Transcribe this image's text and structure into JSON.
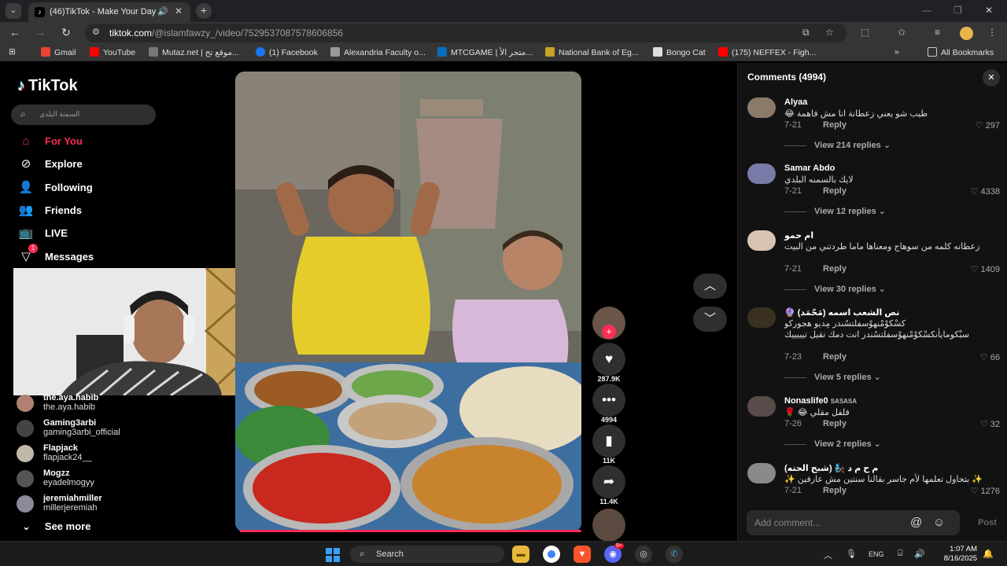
{
  "browser": {
    "tab_title": "(46)TikTok - Make Your Day",
    "url_host": "tiktok.com",
    "url_path": "/@islamfawzy_/video/7529537087578606856",
    "bookmarks": [
      "Gmail",
      "YouTube",
      "Mutaz.net | موقع تح...",
      "(1) Facebook",
      "Alexandria Faculty o...",
      "MTCGAME | متجر الأ...",
      "National Bank of Eg...",
      "Bongo Cat",
      "(175) NEFFEX - Figh..."
    ],
    "all_bookmarks": "All Bookmarks"
  },
  "sidebar": {
    "logo": "TikTok",
    "search_placeholder": "السمنة البلدي",
    "nav": [
      {
        "label": "For You",
        "icon": "home-icon"
      },
      {
        "label": "Explore",
        "icon": "compass-icon"
      },
      {
        "label": "Following",
        "icon": "following-icon"
      },
      {
        "label": "Friends",
        "icon": "friends-icon"
      },
      {
        "label": "LIVE",
        "icon": "live-icon"
      },
      {
        "label": "Messages",
        "icon": "messages-icon",
        "badge": "1"
      }
    ],
    "following": [
      {
        "name": "the.aya.habib",
        "user": "the.aya.habib"
      },
      {
        "name": "Gaming3arbi",
        "user": "gaming3arbi_official"
      },
      {
        "name": "Flapjack",
        "user": "flapjack24__"
      },
      {
        "name": "Mogzz",
        "user": "eyadelmogyy"
      },
      {
        "name": "jeremiahmiller",
        "user": "millerjeremiah"
      }
    ],
    "see_more": "See more"
  },
  "actions": {
    "likes": "287.9K",
    "comments": "4994",
    "saves": "11K",
    "shares": "11.4K"
  },
  "comments": {
    "title": "Comments (4994)",
    "items": [
      {
        "name": "Alyaa",
        "text": "طيب شو يعني زعطانة انا مش فاهمة 😂",
        "date": "7-21",
        "likes": "297",
        "view_replies": "View 214 replies"
      },
      {
        "name": "Samar Abdo",
        "text": "لايك بالسمنه البلدي",
        "date": "7-21",
        "likes": "4338",
        "view_replies": "View 12 replies"
      },
      {
        "name": "ام حمو",
        "text": "زعطانه كلمه من سوهاج ومعناها ماما طردتني من البيت",
        "date": "7-21",
        "likes": "1409",
        "view_replies": "View 30 replies"
      },
      {
        "name": "نص الشعب اسمه (مَحّمَد) 🔮",
        "text": "كسْكوْمْنهوْسفلتسُندر مِديو هجورکو سبْكوماياٰنكسْكوْمْنهوْسفلتسُندر انت دمك تقيل تيييييك",
        "date": "7-23",
        "likes": "66",
        "view_replies": "View 5 replies"
      },
      {
        "name": "Nonaslife0",
        "name_suffix": "SASASA",
        "text": "فلفل مقلي 😂 🌹",
        "date": "7-26",
        "likes": "32",
        "view_replies": "View 2 replies"
      },
      {
        "name": "م ح م د 🧞 (شبح الحته)",
        "text": "✨ بتحاول تعلمها لأم جاسر بقالنا سنتين مش عارفين ✨",
        "date": "7-21",
        "likes": "1276",
        "view_replies": ""
      }
    ],
    "reply_label": "Reply",
    "add_placeholder": "Add comment...",
    "post_label": "Post"
  },
  "taskbar": {
    "search_label": "Search",
    "lang": "ENG",
    "time": "1:07 AM",
    "date": "8/16/2025",
    "badge": "9+"
  }
}
